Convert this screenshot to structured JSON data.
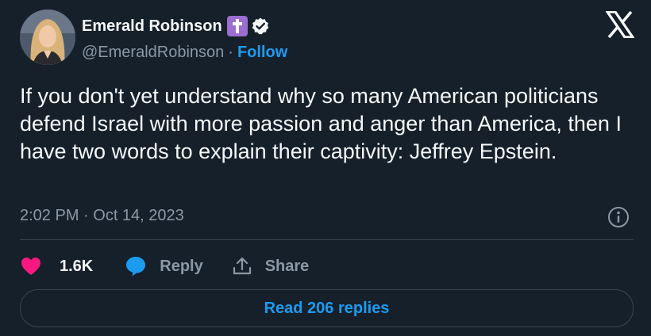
{
  "author": {
    "display_name": "Emerald Robinson",
    "handle": "@EmeraldRobinson",
    "separator": "·",
    "follow_label": "Follow",
    "avatar_icon": "profile-photo",
    "badge_icons": [
      "latin-cross-emoji",
      "verified-badge-icon"
    ]
  },
  "tweet": {
    "text": "If you don't yet understand why so many American politicians defend Israel with more passion and anger than America, then I have two words to explain their captivity: Jeffrey Epstein.",
    "timestamp": "2:02 PM · Oct 14, 2023"
  },
  "actions": {
    "likes_count": "1.6K",
    "reply_label": "Reply",
    "share_label": "Share"
  },
  "footer": {
    "read_replies_label": "Read 206 replies"
  },
  "colors": {
    "background": "#15202b",
    "text": "#f7f9f9",
    "secondary": "#8b98a5",
    "accent": "#1d9bf0",
    "like": "#f91880",
    "border": "#38444d",
    "cross_badge": "#9b6ed0"
  }
}
